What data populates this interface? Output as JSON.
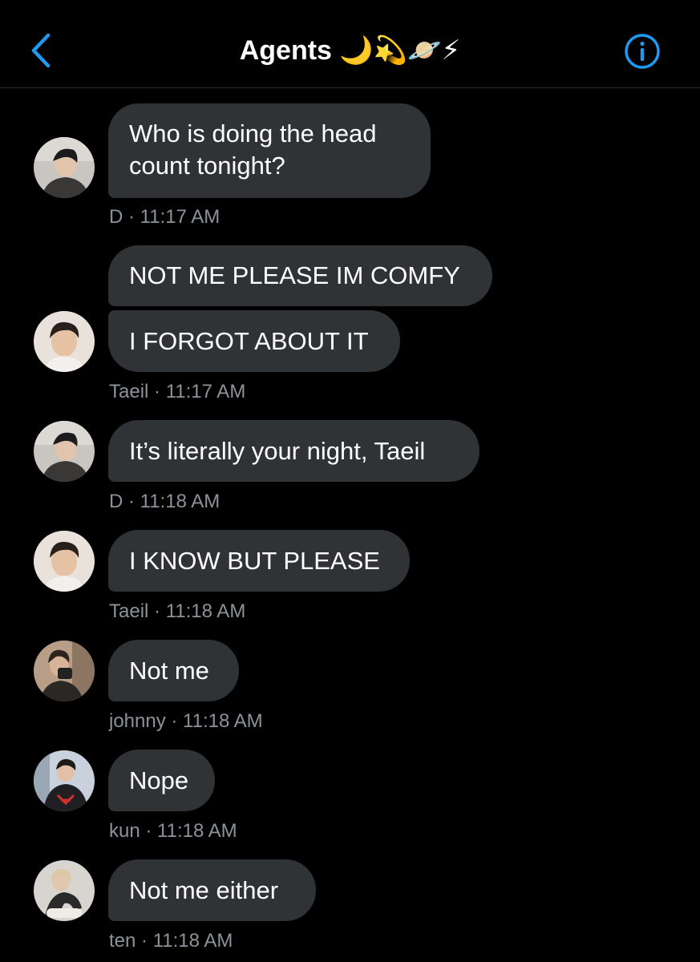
{
  "header": {
    "back_icon": "chevron-left-icon",
    "title": "Agents 🌙💫🪐⚡",
    "info_icon": "info-circle-icon",
    "accent_color": "#1d9bf0"
  },
  "messages": [
    {
      "text": "Who is doing the head count tonight?",
      "meta": "D · 11:17 AM"
    },
    {
      "text": "NOT ME PLEASE IM COMFY"
    },
    {
      "text": "I FORGOT ABOUT IT",
      "meta": "Taeil · 11:17 AM"
    },
    {
      "text": "It’s literally your night, Taeil",
      "meta": "D · 11:18 AM"
    },
    {
      "text": "I KNOW BUT PLEASE",
      "meta": "Taeil · 11:18 AM"
    },
    {
      "text": "Not me",
      "meta": "johnny · 11:18 AM"
    },
    {
      "text": "Nope",
      "meta": "kun · 11:18 AM"
    },
    {
      "text": "Not me either",
      "meta": "ten · 11:18 AM"
    }
  ],
  "colors": {
    "background": "#000000",
    "bubble": "#2f3336",
    "meta_text": "#8b9399"
  }
}
